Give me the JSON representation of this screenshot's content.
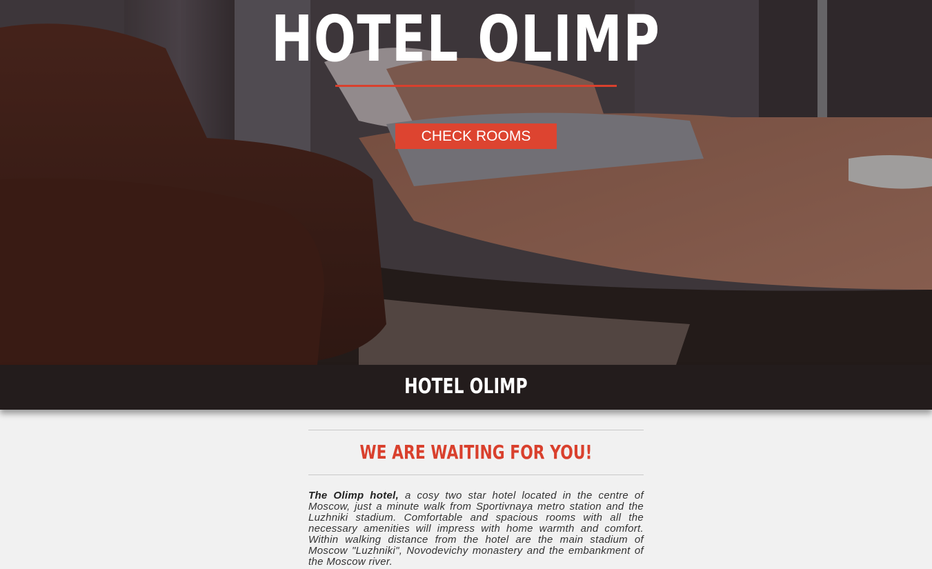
{
  "hero": {
    "title": "HOTEL OLIMP",
    "cta_label": "CHECK ROOMS"
  },
  "band": {
    "title": "HOTEL OLIMP"
  },
  "about": {
    "heading": "WE ARE WAITING FOR YOU!",
    "lead": "The Olimp hotel,",
    "body": " a cosy two star hotel located in the centre of Moscow, just a minute walk from Sportivnaya metro station and the Luzhniki stadium. Comfortable and spacious rooms with all the necessary amenities will impress with home warmth and comfort. Within walking distance from the hotel are the main stadium of Moscow \"Luzhniki\", Novodevichy monastery and the embankment of the Moscow river."
  },
  "colors": {
    "accent": "#dd4430",
    "band": "#231c1c",
    "page_background": "#f1f1f1"
  }
}
